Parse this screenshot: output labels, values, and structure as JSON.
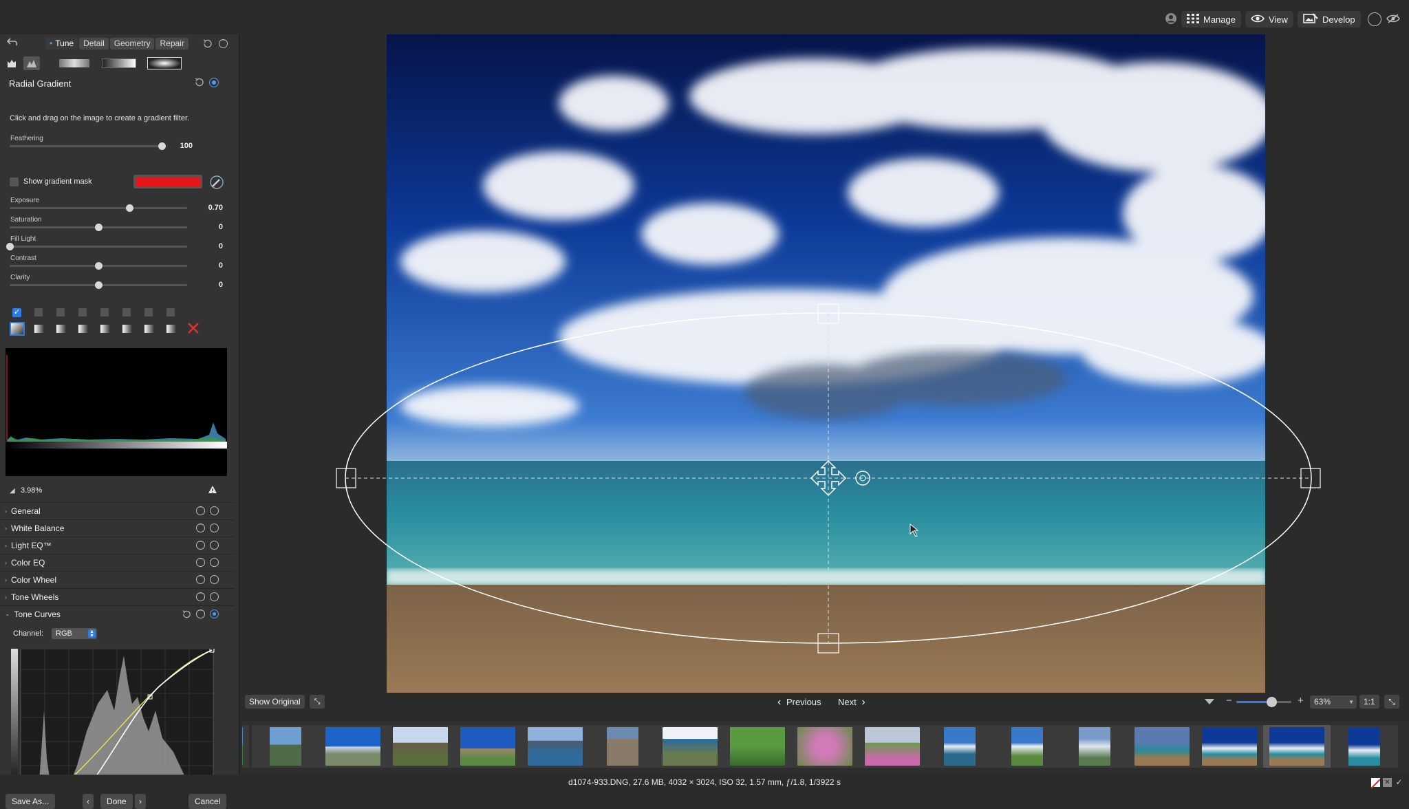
{
  "topbar": {
    "manage_label": "Manage",
    "view_label": "View",
    "develop_label": "Develop"
  },
  "panel": {
    "tabs": [
      "Tune",
      "Detail",
      "Geometry",
      "Repair"
    ],
    "active_tab": "Tune",
    "title": "Radial Gradient",
    "hint": "Click and drag on the image to create a gradient filter.",
    "feathering": {
      "label": "Feathering",
      "value": "100",
      "level": 1.0
    },
    "show_mask_label": "Show gradient mask",
    "show_mask_checked": false,
    "mask_color": "#e3171a",
    "sliders": [
      {
        "label": "Exposure",
        "value": "0.70",
        "level": 0.68
      },
      {
        "label": "Saturation",
        "value": "0",
        "level": 0.5
      },
      {
        "label": "Fill Light",
        "value": "0",
        "level": 0.0
      },
      {
        "label": "Contrast",
        "value": "0",
        "level": 0.5
      },
      {
        "label": "Clarity",
        "value": "0",
        "level": 0.5
      }
    ],
    "clipping_percent": "3.98%",
    "sections": [
      "General",
      "White Balance",
      "Light EQ™",
      "Color EQ",
      "Color Wheel",
      "Tone Wheels",
      "Tone Curves"
    ],
    "channel_label": "Channel:",
    "channel_value": "RGB"
  },
  "bottom_buttons": {
    "save_as": "Save As...",
    "done": "Done",
    "cancel": "Cancel"
  },
  "viewer": {
    "show_original": "Show Original",
    "previous": "Previous",
    "next": "Next",
    "zoom": "63%",
    "one_to_one": "1:1",
    "zoom_level": 0.55
  },
  "status": "d1074-933.DNG, 27.6 MB, 4032 × 3024, ISO 32, 1.57 mm, ƒ/1.8, 1/3922 s",
  "colors": {
    "accent": "#2f7de1",
    "sky_top": "#06144a",
    "sea": "#2a8fa0",
    "sand": "#8a6a48"
  }
}
